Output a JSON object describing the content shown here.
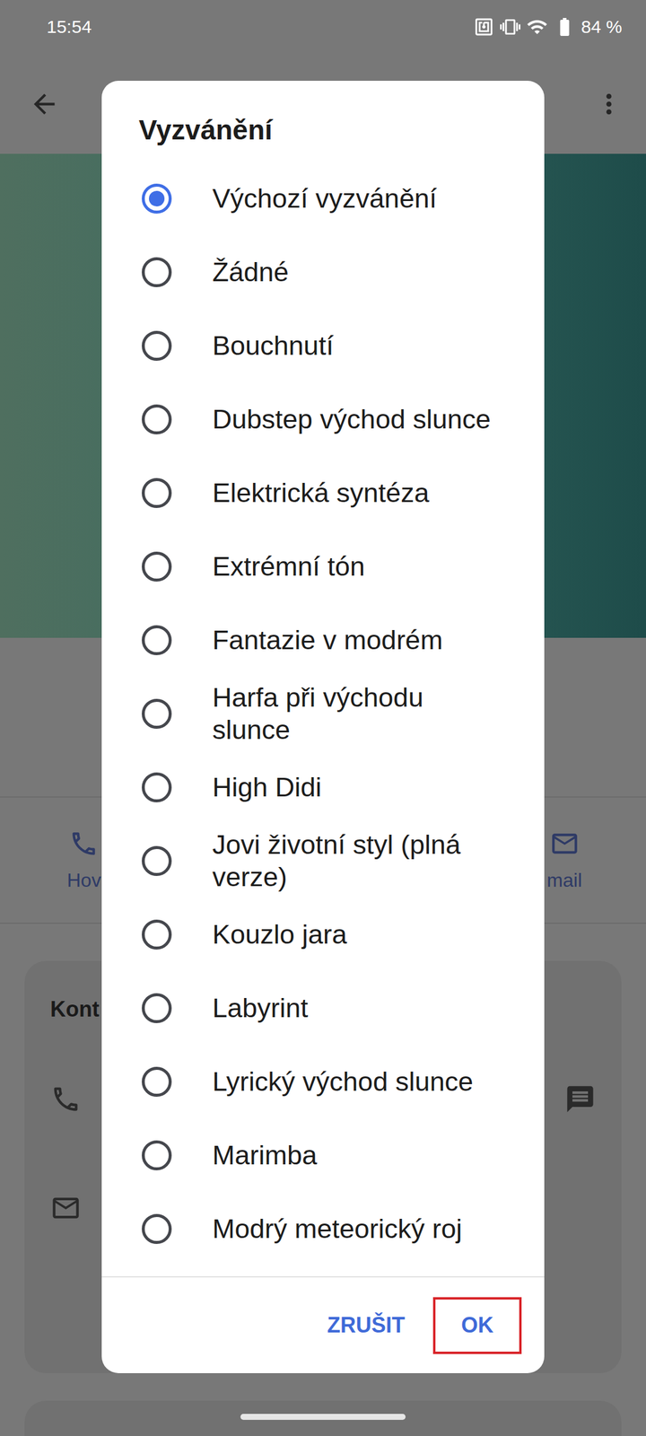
{
  "status_bar": {
    "time": "15:54",
    "battery": "84 %"
  },
  "contact": {
    "actions": [
      {
        "label": "Hov"
      },
      {
        "label": "mail"
      }
    ],
    "card_title": "Kont"
  },
  "dialog": {
    "title": "Vyzvánění",
    "options": [
      {
        "label": "Výchozí vyzvánění",
        "selected": true
      },
      {
        "label": "Žádné",
        "selected": false
      },
      {
        "label": "Bouchnutí",
        "selected": false
      },
      {
        "label": "Dubstep východ slunce",
        "selected": false
      },
      {
        "label": "Elektrická syntéza",
        "selected": false
      },
      {
        "label": "Extrémní tón",
        "selected": false
      },
      {
        "label": "Fantazie v modrém",
        "selected": false
      },
      {
        "label": "Harfa při východu slunce",
        "selected": false
      },
      {
        "label": "High Didi",
        "selected": false
      },
      {
        "label": "Jovi životní styl (plná verze)",
        "selected": false
      },
      {
        "label": "Kouzlo jara",
        "selected": false
      },
      {
        "label": "Labyrint",
        "selected": false
      },
      {
        "label": "Lyrický východ slunce",
        "selected": false
      },
      {
        "label": "Marimba",
        "selected": false
      },
      {
        "label": "Modrý meteorický roj",
        "selected": false
      }
    ],
    "buttons": [
      {
        "label": "ZRUŠIT",
        "highlighted": false
      },
      {
        "label": "OK",
        "highlighted": true
      }
    ]
  }
}
